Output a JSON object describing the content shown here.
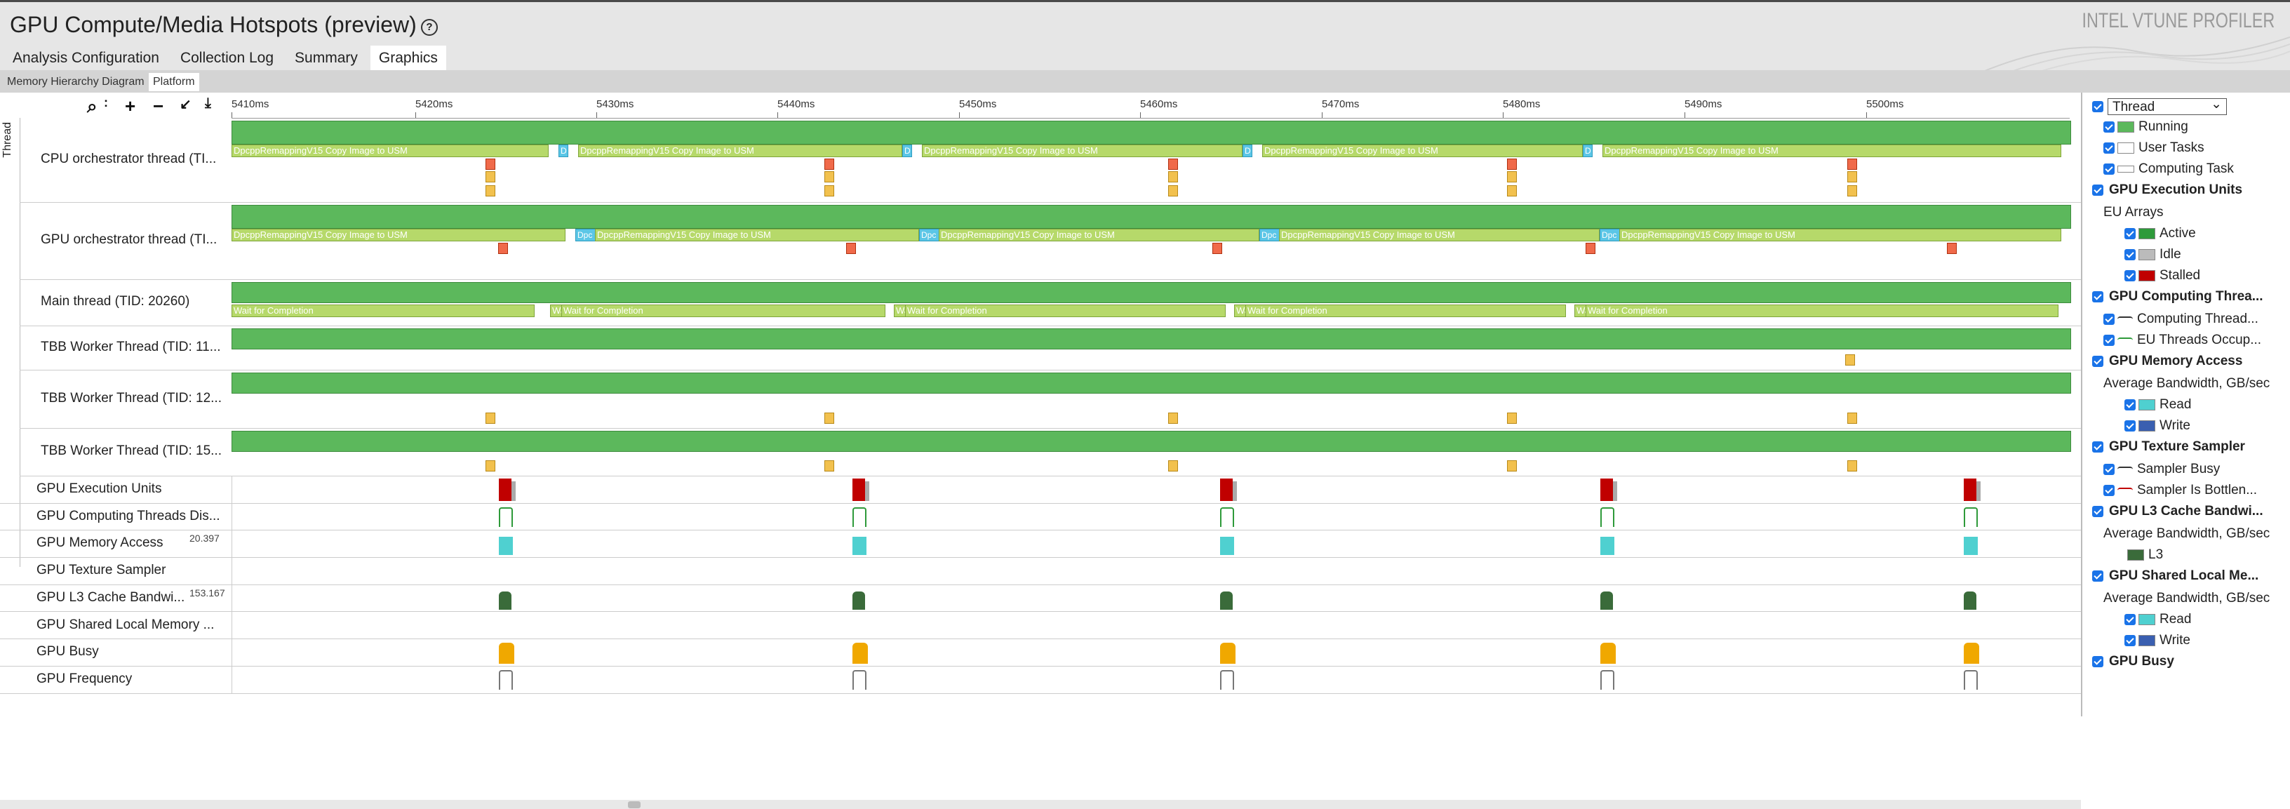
{
  "header": {
    "title": "GPU Compute/Media Hotspots (preview)",
    "brand": "INTEL VTUNE PROFILER"
  },
  "tabs": [
    "Analysis Configuration",
    "Collection Log",
    "Summary",
    "Graphics"
  ],
  "subtabs": [
    "Memory Hierarchy Diagram",
    "Platform"
  ],
  "ruler": {
    "ticks": [
      "5410ms",
      "5420ms",
      "5430ms",
      "5440ms",
      "5450ms",
      "5460ms",
      "5470ms",
      "5480ms",
      "5490ms",
      "5500ms"
    ]
  },
  "thread_group_label": "Thread",
  "threads": [
    {
      "name": "CPU orchestrator thread (TI...",
      "task": "DpcppRemappingV15 Copy Image to USM",
      "short": "D"
    },
    {
      "name": "GPU orchestrator thread (TI...",
      "task": "DpcppRemappingV15 Copy Image to USM",
      "short": "Dpc"
    },
    {
      "name": "Main thread (TID: 20260)",
      "task": "Wait for Completion",
      "short": "Wa"
    },
    {
      "name": "TBB Worker Thread (TID: 11..."
    },
    {
      "name": "TBB Worker Thread (TID: 12..."
    },
    {
      "name": "TBB Worker Thread (TID: 15..."
    }
  ],
  "gpu_rows": [
    {
      "name": "GPU Execution Units",
      "value": ""
    },
    {
      "name": "GPU Computing Threads Dis...",
      "value": ""
    },
    {
      "name": "GPU Memory Access",
      "value": "20.397"
    },
    {
      "name": "GPU Texture Sampler",
      "value": ""
    },
    {
      "name": "GPU L3 Cache Bandwi...",
      "value": "153.167"
    },
    {
      "name": "GPU Shared Local Memory ...",
      "value": ""
    },
    {
      "name": "GPU Busy",
      "value": ""
    },
    {
      "name": "GPU Frequency",
      "value": ""
    }
  ],
  "side": {
    "select": "Thread",
    "items": [
      {
        "label": "Running",
        "indent": 1
      },
      {
        "label": "User Tasks",
        "indent": 1
      },
      {
        "label": "Computing Task",
        "indent": 1
      },
      {
        "label": "GPU Execution Units",
        "head": true
      },
      {
        "label": "EU Arrays",
        "plain": true
      },
      {
        "label": "Active",
        "indent": 2
      },
      {
        "label": "Idle",
        "indent": 2
      },
      {
        "label": "Stalled",
        "indent": 2
      },
      {
        "label": "GPU Computing Threa...",
        "head": true
      },
      {
        "label": "Computing Thread...",
        "indent": 1
      },
      {
        "label": "EU Threads Occup...",
        "indent": 1
      },
      {
        "label": "GPU Memory Access",
        "head": true
      },
      {
        "label": "Average Bandwidth, GB/sec",
        "plain": true
      },
      {
        "label": "Read",
        "indent": 2
      },
      {
        "label": "Write",
        "indent": 2
      },
      {
        "label": "GPU Texture Sampler",
        "head": true
      },
      {
        "label": "Sampler Busy",
        "indent": 1
      },
      {
        "label": "Sampler Is Bottlen...",
        "indent": 1
      },
      {
        "label": "GPU L3 Cache Bandwi...",
        "head": true
      },
      {
        "label": "Average Bandwidth, GB/sec",
        "plain": true
      },
      {
        "label": "L3",
        "plain2": true
      },
      {
        "label": "GPU Shared Local Me...",
        "head": true
      },
      {
        "label": "Average Bandwidth, GB/sec",
        "plain": true
      },
      {
        "label": "Read",
        "indent": 2
      },
      {
        "label": "Write",
        "indent": 2
      },
      {
        "label": "GPU Busy",
        "head": true
      }
    ]
  }
}
